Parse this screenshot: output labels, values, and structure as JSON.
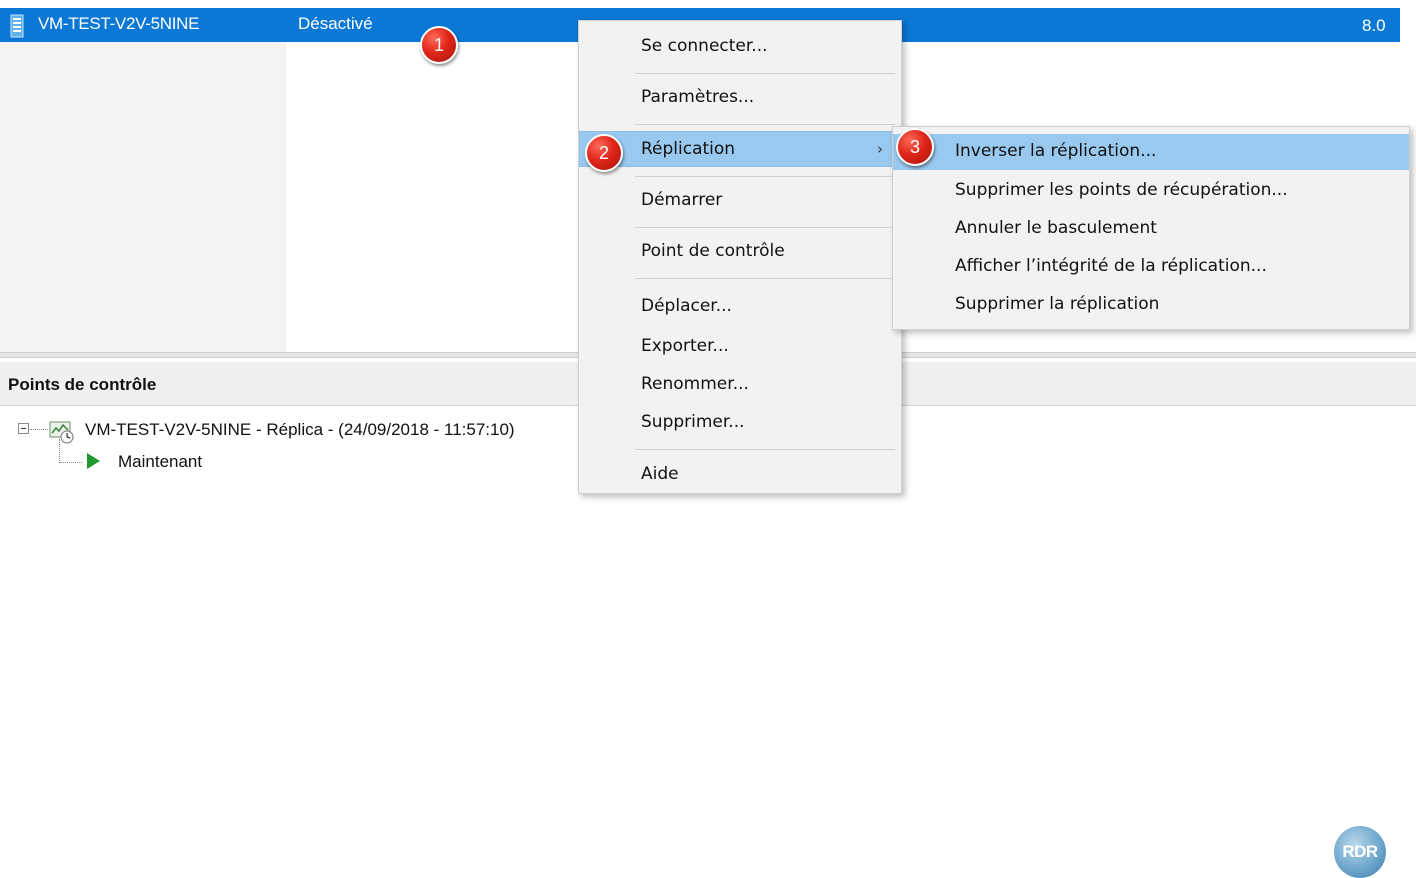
{
  "vm_list": {
    "selected_vm": {
      "name": "VM-TEST-V2V-5NINE",
      "state": "Désactivé",
      "version": "8.0"
    }
  },
  "checkpoints": {
    "title": "Points de contrôle",
    "tree": {
      "root_label": "VM-TEST-V2V-5NINE - Réplica - (24/09/2018 - 11:57:10)",
      "child_label": "Maintenant"
    }
  },
  "context_menu": {
    "items": [
      {
        "label": "Se connecter..."
      },
      {
        "label": "Paramètres..."
      },
      {
        "label": "Réplication",
        "has_submenu": true,
        "highlighted": true
      },
      {
        "label": "Démarrer"
      },
      {
        "label": "Point de contrôle"
      },
      {
        "label": "Déplacer..."
      },
      {
        "label": "Exporter..."
      },
      {
        "label": "Renommer..."
      },
      {
        "label": "Supprimer..."
      },
      {
        "label": "Aide"
      }
    ],
    "submenu_arrow": "›"
  },
  "replication_submenu": {
    "items": [
      {
        "label": "Inverser la réplication...",
        "highlighted": true
      },
      {
        "label": "Supprimer les points de récupération..."
      },
      {
        "label": "Annuler le basculement"
      },
      {
        "label": "Afficher l’intégrité de la réplication..."
      },
      {
        "label": "Supprimer la réplication"
      }
    ]
  },
  "callouts": [
    "1",
    "2",
    "3"
  ],
  "watermark": {
    "text": "RDR"
  },
  "icons": {
    "vm_icon": "server-icon",
    "snapshot_icon": "snapshot-icon",
    "now_icon": "play-icon",
    "tree_expander": "collapse-icon"
  },
  "colors": {
    "selection_blue": "#0a78d4",
    "menu_highlight": "#99c9ef",
    "menu_background": "#f2f2f2",
    "callout_red": "#e0261b"
  }
}
